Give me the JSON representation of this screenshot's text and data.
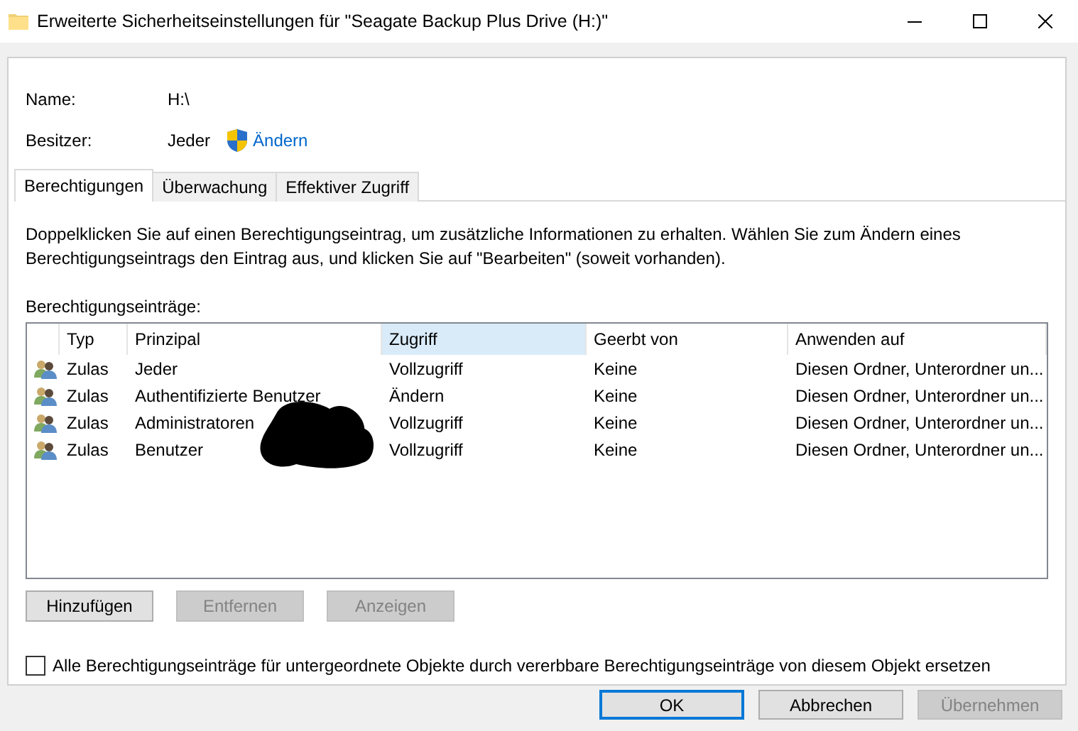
{
  "window": {
    "title": "Erweiterte Sicherheitseinstellungen für \"Seagate Backup Plus Drive (H:)\""
  },
  "name": {
    "label": "Name:",
    "value": "H:\\"
  },
  "owner": {
    "label": "Besitzer:",
    "value": "Jeder",
    "link": "Ändern"
  },
  "tabs": [
    {
      "label": "Berechtigungen",
      "selected": true
    },
    {
      "label": "Überwachung",
      "selected": false
    },
    {
      "label": "Effektiver Zugriff",
      "selected": false
    }
  ],
  "description": "Doppelklicken Sie auf einen Berechtigungseintrag, um zusätzliche Informationen zu erhalten. Wählen Sie zum Ändern eines Berechtigungseintrags den Eintrag aus, und klicken Sie auf \"Bearbeiten\" (soweit vorhanden).",
  "list_label": "Berechtigungseinträge:",
  "table": {
    "columns": [
      {
        "label": "Typ",
        "highlighted": false
      },
      {
        "label": "Prinzipal",
        "highlighted": false
      },
      {
        "label": "Zugriff",
        "highlighted": true
      },
      {
        "label": "Geerbt von",
        "highlighted": false
      },
      {
        "label": "Anwenden auf",
        "highlighted": false
      }
    ],
    "rows": [
      {
        "type": "Zulas",
        "principal": "Jeder",
        "access": "Vollzugriff",
        "inherited": "Keine",
        "applies": "Diesen Ordner, Unterordner un..."
      },
      {
        "type": "Zulas",
        "principal": "Authentifizierte Benutzer",
        "access": "Ändern",
        "inherited": "Keine",
        "applies": "Diesen Ordner, Unterordner un..."
      },
      {
        "type": "Zulas",
        "principal": "Administratoren",
        "access": "Vollzugriff",
        "inherited": "Keine",
        "applies": "Diesen Ordner, Unterordner un..."
      },
      {
        "type": "Zulas",
        "principal": "Benutzer",
        "access": "Vollzugriff",
        "inherited": "Keine",
        "applies": "Diesen Ordner, Unterordner un..."
      }
    ]
  },
  "list_buttons": [
    {
      "label": "Hinzufügen",
      "disabled": false
    },
    {
      "label": "Entfernen",
      "disabled": true
    },
    {
      "label": "Anzeigen",
      "disabled": true
    }
  ],
  "replace_checkbox": {
    "label": "Alle Berechtigungseinträge für untergeordnete Objekte durch vererbbare Berechtigungseinträge von diesem Objekt ersetzen",
    "checked": false
  },
  "dialog_buttons": [
    {
      "label": "OK",
      "default": true,
      "disabled": false
    },
    {
      "label": "Abbrechen",
      "default": false,
      "disabled": false
    },
    {
      "label": "Übernehmen",
      "default": false,
      "disabled": true
    }
  ]
}
